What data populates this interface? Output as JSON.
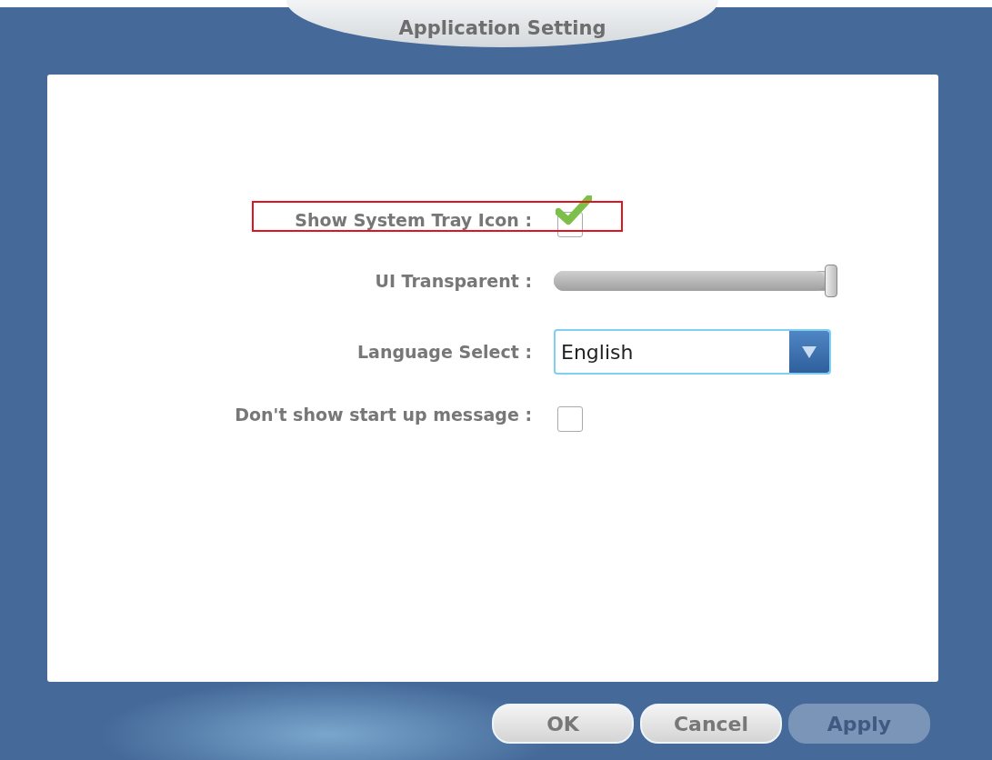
{
  "window": {
    "title": "Application Setting"
  },
  "settings": [
    {
      "kind": "checkbox",
      "label": "Show System Tray Icon :",
      "checked": true,
      "highlighted": true
    },
    {
      "kind": "slider",
      "label": "UI Transparent :",
      "level": 1.0
    },
    {
      "kind": "dropdown",
      "label": "Language Select :",
      "value": "English"
    },
    {
      "kind": "checkbox",
      "label": "Don't show start up message :",
      "checked": false,
      "highlighted": false
    }
  ],
  "buttons": [
    {
      "label": "OK",
      "disabled": false
    },
    {
      "label": "Cancel",
      "disabled": false
    },
    {
      "label": "Apply",
      "disabled": true
    }
  ]
}
